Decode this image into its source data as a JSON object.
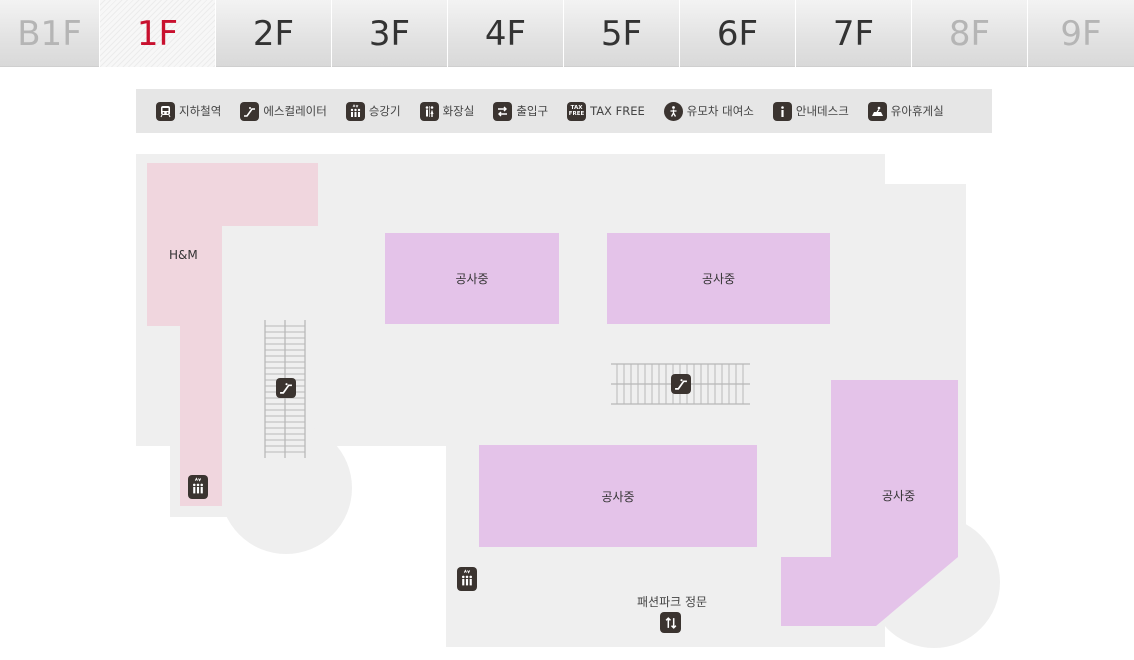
{
  "floors": [
    {
      "label": "B1F",
      "state": "disabled"
    },
    {
      "label": "1F",
      "state": "active"
    },
    {
      "label": "2F",
      "state": "normal"
    },
    {
      "label": "3F",
      "state": "normal"
    },
    {
      "label": "4F",
      "state": "normal"
    },
    {
      "label": "5F",
      "state": "normal"
    },
    {
      "label": "6F",
      "state": "normal"
    },
    {
      "label": "7F",
      "state": "normal"
    },
    {
      "label": "8F",
      "state": "disabled"
    },
    {
      "label": "9F",
      "state": "disabled"
    }
  ],
  "legend": [
    {
      "label": "지하철역",
      "icon": "subway-icon"
    },
    {
      "label": "에스컬레이터",
      "icon": "escalator-icon"
    },
    {
      "label": "승강기",
      "icon": "elevator-icon"
    },
    {
      "label": "화장실",
      "icon": "restroom-icon"
    },
    {
      "label": "출입구",
      "icon": "entrance-icon"
    },
    {
      "label": "TAX FREE",
      "icon": "tax-free-icon"
    },
    {
      "label": "유모차 대여소",
      "icon": "stroller-rental-icon"
    },
    {
      "label": "안내데스크",
      "icon": "info-desk-icon"
    },
    {
      "label": "유아휴게실",
      "icon": "nursing-room-icon"
    }
  ],
  "tax_icon_text": [
    "TAX",
    "FREE"
  ],
  "stores": {
    "hm": "H&M",
    "construction_1": "공사중",
    "construction_2": "공사중",
    "construction_3": "공사중",
    "construction_4": "공사중"
  },
  "main_gate": "패션파크 정문",
  "colors": {
    "active_tab": "#c8102e",
    "store_fill": "#e4c3e9",
    "hm_fill": "#f0d6de",
    "floor_fill": "#efefef",
    "icon_fill": "#3b3430"
  }
}
